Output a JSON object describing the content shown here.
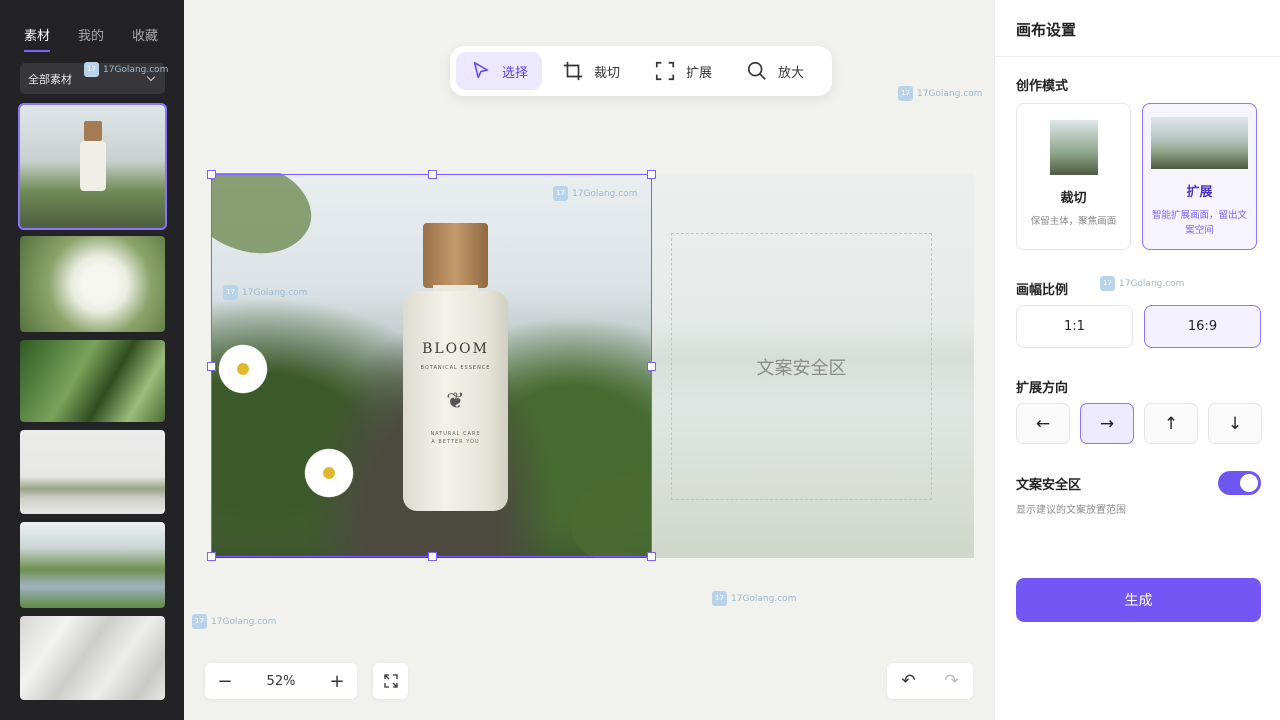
{
  "sidebar": {
    "tabs": [
      {
        "label": "素材",
        "active": true
      },
      {
        "label": "我的",
        "active": false
      },
      {
        "label": "收藏",
        "active": false
      }
    ],
    "filter": "全部素材"
  },
  "toolbar": {
    "tools": [
      {
        "label": "选择",
        "icon": "cursor-icon",
        "active": true
      },
      {
        "label": "裁切",
        "icon": "crop-icon",
        "active": false
      },
      {
        "label": "扩展",
        "icon": "expand-icon",
        "active": false
      },
      {
        "label": "放大",
        "icon": "magnify-icon",
        "active": false
      }
    ]
  },
  "canvas": {
    "product": {
      "name": "BLOOM",
      "subtitle": "BOTANICAL ESSENCE",
      "tagline_1": "NATURAL CARE",
      "tagline_2": "A BETTER YOU"
    },
    "safe_zone_label": "文案安全区"
  },
  "bottom": {
    "zoom": "52%",
    "zoom_out": "−",
    "zoom_in": "+",
    "undo": "↶",
    "redo": "↷"
  },
  "watermark": {
    "text": "17Golang.com",
    "logo": "17"
  },
  "panel": {
    "title": "画布设置",
    "mode_title": "创作模式",
    "modes": [
      {
        "name": "裁切",
        "desc": "保留主体，聚焦画面",
        "active": false
      },
      {
        "name": "扩展",
        "desc": "智能扩展画面，留出文案空间",
        "active": true
      }
    ],
    "ratio_title": "画幅比例",
    "ratios": [
      {
        "label": "1:1",
        "active": false
      },
      {
        "label": "16:9",
        "active": true
      }
    ],
    "direction_title": "扩展方向",
    "directions": [
      {
        "label": "←",
        "active": false
      },
      {
        "label": "→",
        "active": true
      },
      {
        "label": "↑",
        "active": false
      },
      {
        "label": "↓",
        "active": false
      }
    ],
    "safe_zone_title": "文案安全区",
    "safe_zone_enabled": true,
    "safe_zone_hint": "显示建议的文案放置范围",
    "generate_label": "生成"
  },
  "colors": {
    "accent": "#7357f5",
    "sidebar_bg": "#232326",
    "canvas_bg": "#f1f1ee"
  }
}
